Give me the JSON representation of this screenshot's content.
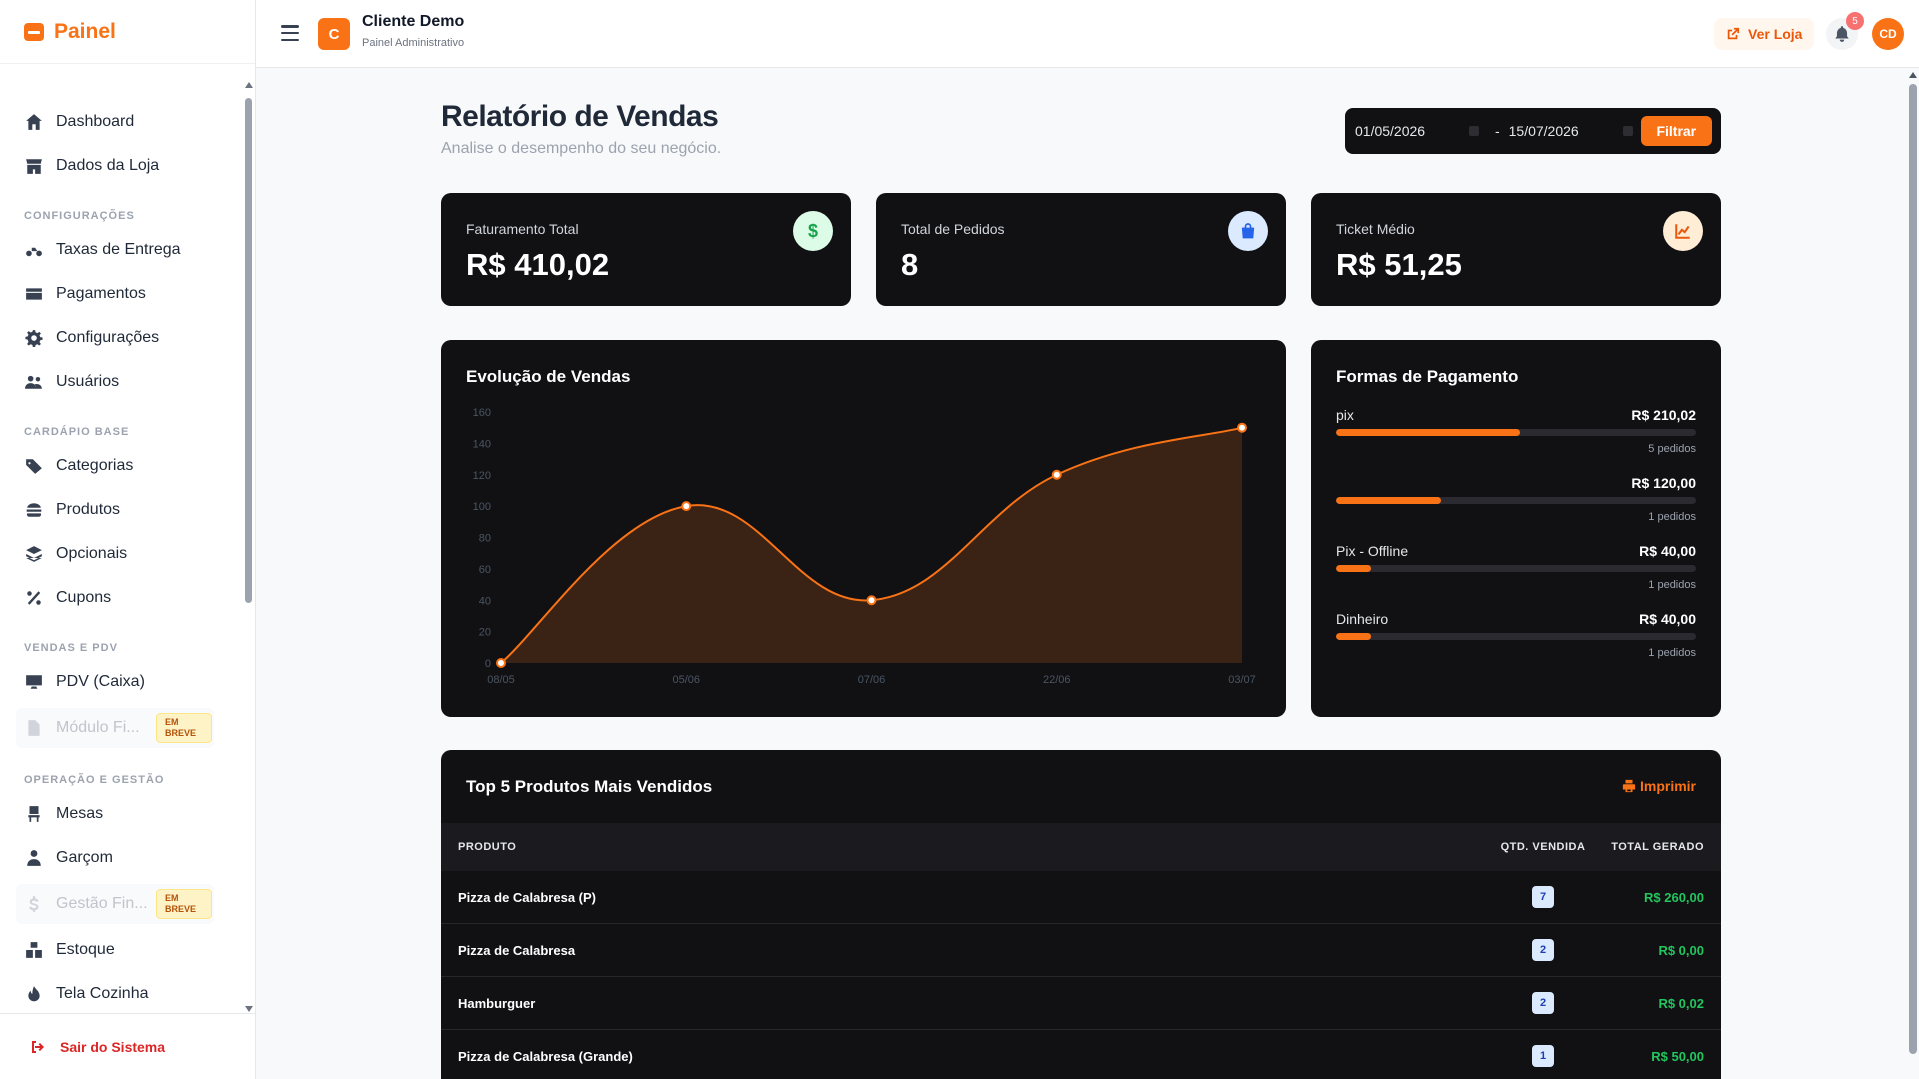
{
  "brand": {
    "name": "Painel"
  },
  "sidebar": {
    "items_top": [
      {
        "label": "Dashboard",
        "icon": "home-icon"
      },
      {
        "label": "Dados da Loja",
        "icon": "store-icon"
      }
    ],
    "sections": [
      {
        "title": "CONFIGURAÇÕES",
        "items": [
          {
            "label": "Taxas de Entrega",
            "icon": "motorcycle-icon"
          },
          {
            "label": "Pagamentos",
            "icon": "credit-card-icon"
          },
          {
            "label": "Configurações",
            "icon": "gear-icon"
          },
          {
            "label": "Usuários",
            "icon": "users-icon"
          }
        ]
      },
      {
        "title": "CARDÁPIO BASE",
        "items": [
          {
            "label": "Categorias",
            "icon": "tags-icon"
          },
          {
            "label": "Produtos",
            "icon": "hamburger-icon"
          },
          {
            "label": "Opcionais",
            "icon": "layers-icon"
          },
          {
            "label": "Cupons",
            "icon": "percent-icon"
          }
        ]
      },
      {
        "title": "VENDAS E PDV",
        "items": [
          {
            "label": "PDV (Caixa)",
            "icon": "monitor-icon"
          },
          {
            "label": "Módulo Fi...",
            "icon": "file-icon",
            "badge": "EM BREVE"
          }
        ]
      },
      {
        "title": "OPERAÇÃO E GESTÃO",
        "items": [
          {
            "label": "Mesas",
            "icon": "chair-icon"
          },
          {
            "label": "Garçom",
            "icon": "user-tie-icon"
          },
          {
            "label": "Gestão Fin...",
            "icon": "dollar-icon",
            "badge": "EM BREVE"
          },
          {
            "label": "Estoque",
            "icon": "boxes-icon"
          },
          {
            "label": "Tela Cozinha",
            "icon": "fire-icon"
          }
        ]
      }
    ],
    "logout": "Sair do Sistema"
  },
  "header": {
    "client_initial": "C",
    "client_name": "Cliente Demo",
    "client_sub": "Painel Administrativo",
    "ver_loja": "Ver Loja",
    "notifications": "5",
    "avatar": "CD"
  },
  "page": {
    "title": "Relatório de Vendas",
    "subtitle": "Analise o desempenho do seu negócio.",
    "date_from": "01/05/2026",
    "date_to": "15/07/2026",
    "filter_label": "Filtrar",
    "date_sep": "-"
  },
  "kpis": [
    {
      "label": "Faturamento Total",
      "value": "R$ 410,02",
      "icon": "dollar-icon",
      "color": "#16a34a",
      "bg": "#dcfce7"
    },
    {
      "label": "Total de Pedidos",
      "value": "8",
      "icon": "bag-icon",
      "color": "#2563eb",
      "bg": "#dbeafe"
    },
    {
      "label": "Ticket Médio",
      "value": "R$ 51,25",
      "icon": "chart-line-icon",
      "color": "#ea580c",
      "bg": "#ffedd5"
    }
  ],
  "chart_data": {
    "type": "area",
    "title": "Evolução de Vendas",
    "categories": [
      "08/05",
      "05/06",
      "07/06",
      "22/06",
      "03/07"
    ],
    "values": [
      0,
      100,
      40,
      120,
      150
    ],
    "ylim": [
      0,
      160
    ],
    "yticks": [
      0,
      20,
      40,
      60,
      80,
      100,
      120,
      140,
      160
    ],
    "color": "#f97316",
    "grid": false
  },
  "payments": {
    "title": "Formas de Pagamento",
    "rows": [
      {
        "name": "pix",
        "value": "R$ 210,02",
        "orders": "5 pedidos",
        "pct": 51.2
      },
      {
        "name": "",
        "value": "R$ 120,00",
        "orders": "1 pedidos",
        "pct": 29.3
      },
      {
        "name": "Pix - Offline",
        "value": "R$ 40,00",
        "orders": "1 pedidos",
        "pct": 9.8
      },
      {
        "name": "Dinheiro",
        "value": "R$ 40,00",
        "orders": "1 pedidos",
        "pct": 9.8
      }
    ]
  },
  "top_products": {
    "title": "Top 5 Produtos Mais Vendidos",
    "print_label": "Imprimir",
    "columns": [
      "PRODUTO",
      "QTD. VENDIDA",
      "TOTAL GERADO"
    ],
    "rows": [
      {
        "product": "Pizza de Calabresa (P)",
        "qty": "7",
        "total": "R$ 260,00"
      },
      {
        "product": "Pizza de Calabresa",
        "qty": "2",
        "total": "R$ 0,00"
      },
      {
        "product": "Hamburguer",
        "qty": "2",
        "total": "R$ 0,02"
      },
      {
        "product": "Pizza de Calabresa (Grande)",
        "qty": "1",
        "total": "R$ 50,00"
      }
    ]
  }
}
